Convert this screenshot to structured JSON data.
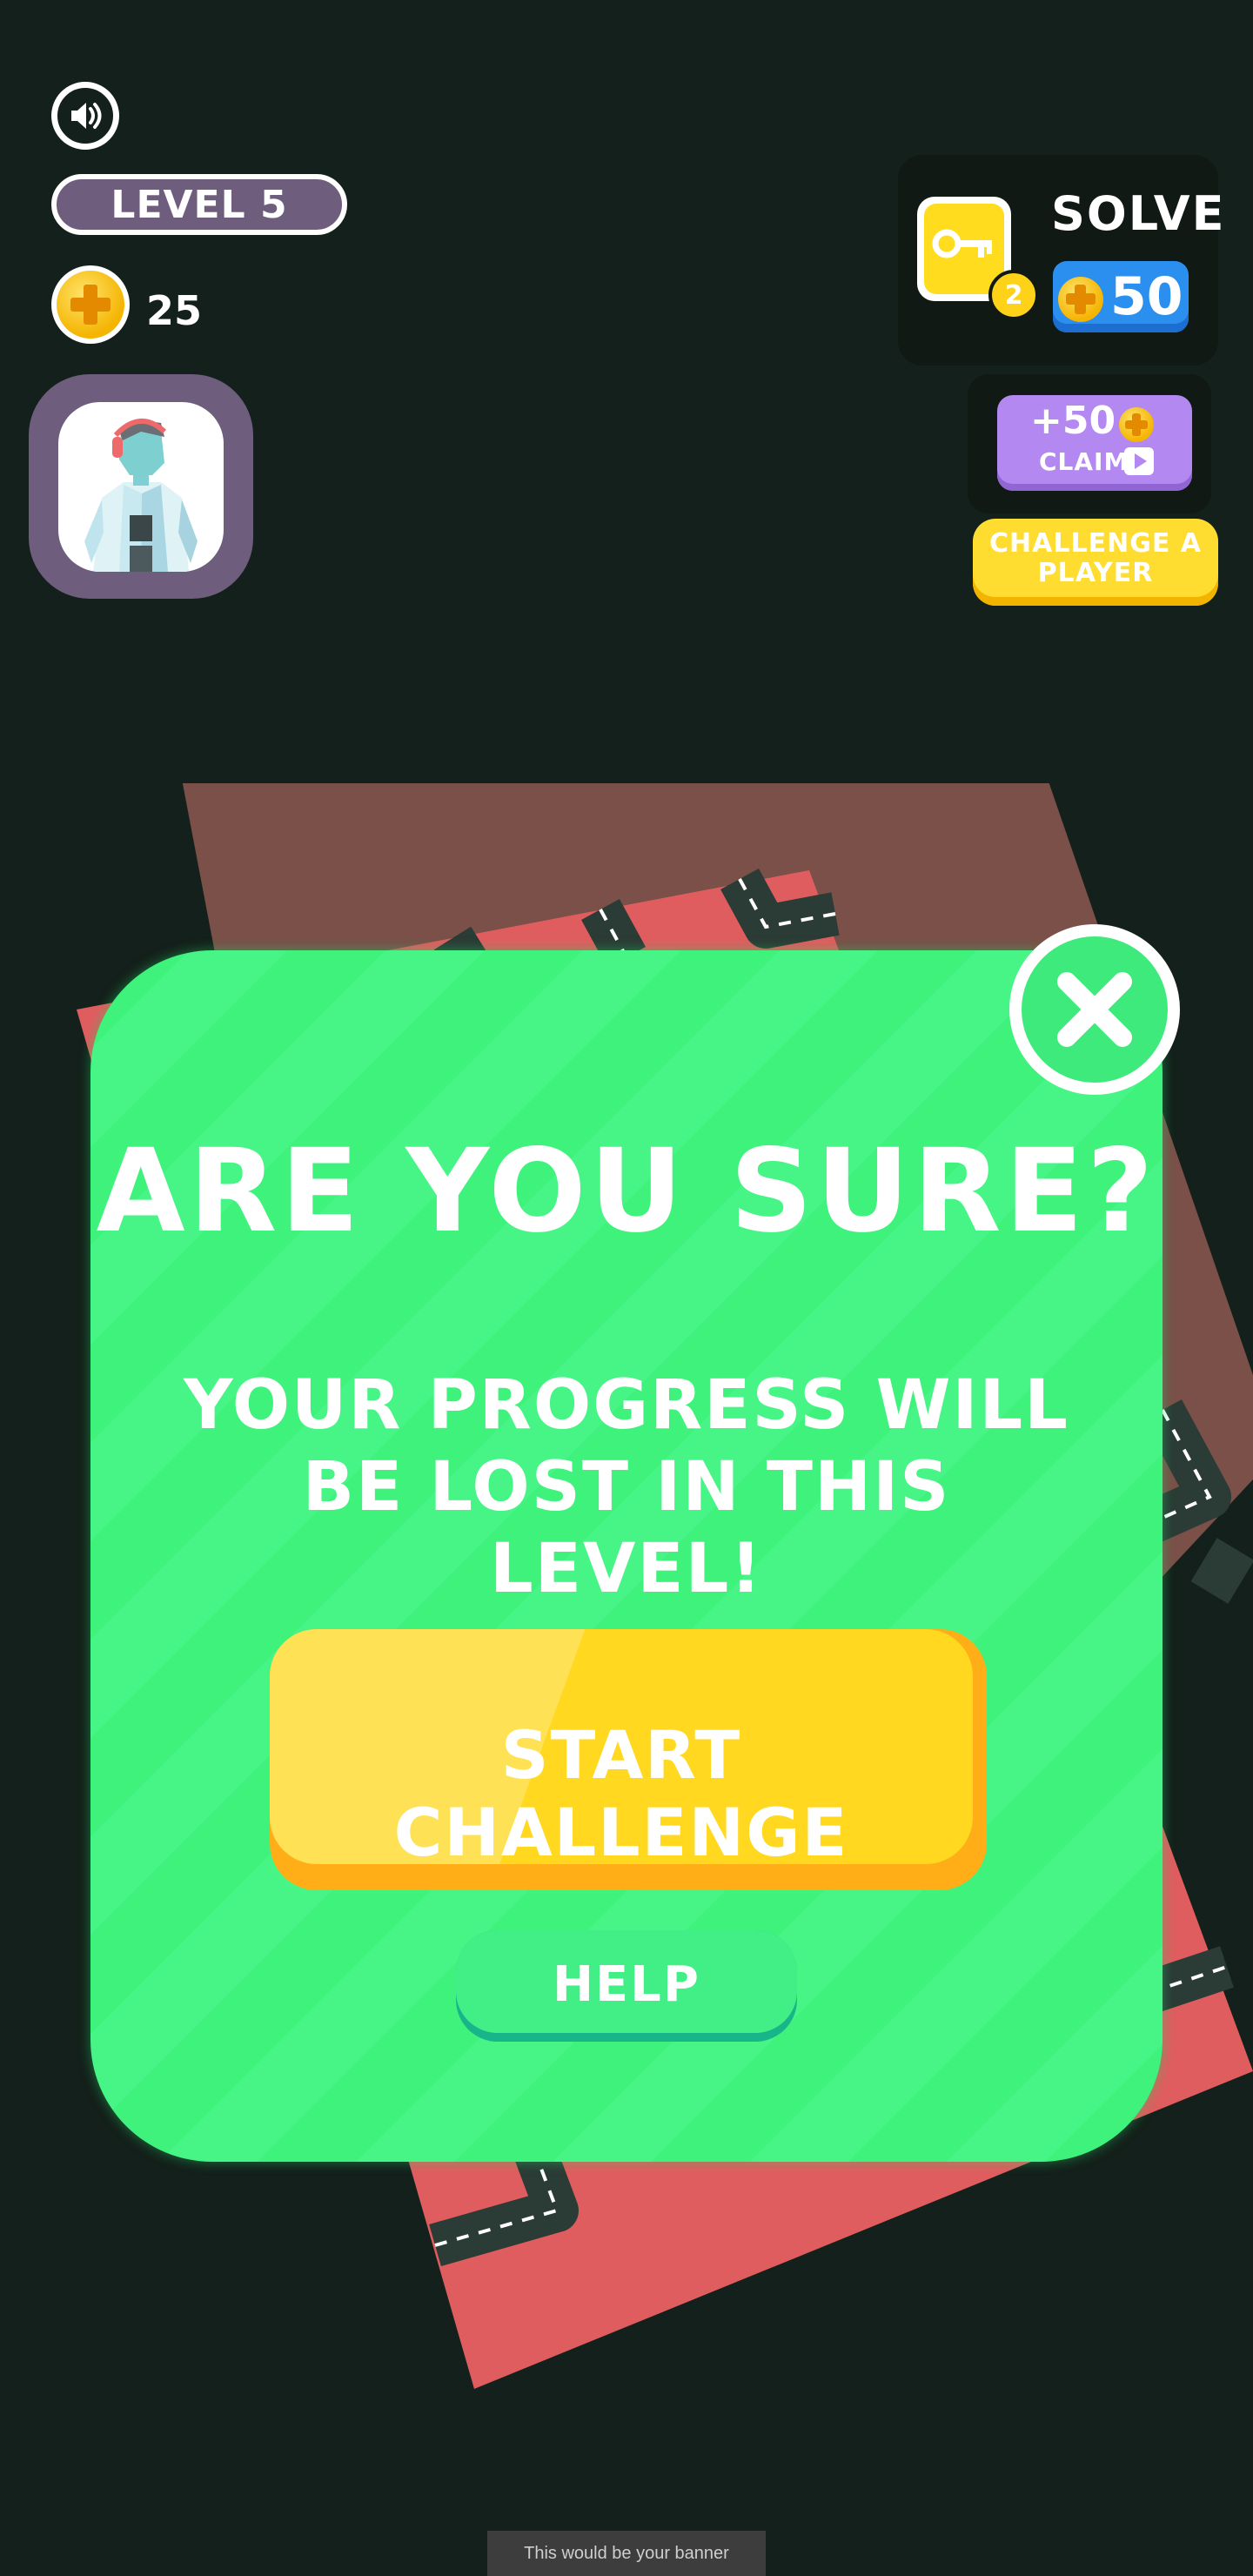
{
  "hud": {
    "sound_icon": "speaker-icon",
    "level_label": "LEVEL 5",
    "coins": "25"
  },
  "solve": {
    "label": "SOLVE",
    "key_count": "2",
    "cost": "50",
    "key_icon": "key-icon"
  },
  "claim": {
    "amount": "+50",
    "label": "CLAIM",
    "play_icon": "play-icon"
  },
  "challenge": {
    "label": "CHALLENGE A PLAYER"
  },
  "modal": {
    "title": "ARE YOU SURE?",
    "message": "YOUR PROGRESS WILL BE LOST IN THIS LEVEL!",
    "primary_label": "START CHALLENGE",
    "secondary_label": "HELP",
    "close_icon": "close-icon"
  },
  "banner": {
    "text": "This would be your banner"
  },
  "colors": {
    "background": "#14201b",
    "modal_green": "#3ef27b",
    "button_yellow": "#ffd81f",
    "board_red": "#e05d5f",
    "road": "#2b3b35"
  }
}
